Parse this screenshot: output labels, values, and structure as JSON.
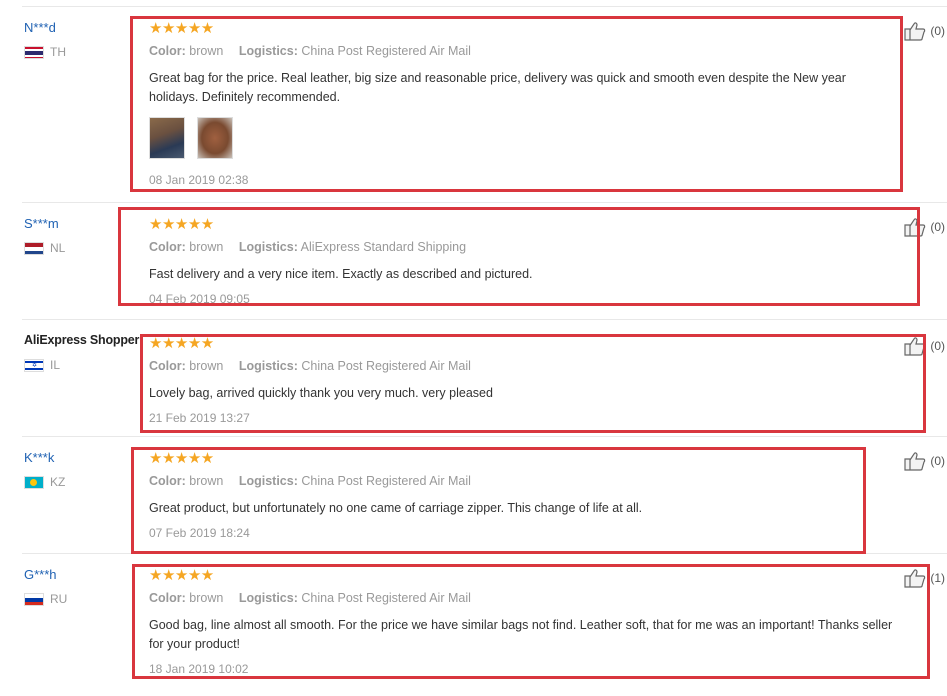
{
  "labels": {
    "color": "Color:",
    "logistics": "Logistics:"
  },
  "reviews": [
    {
      "user": "N***d",
      "country": "TH",
      "stars": "★★★★★",
      "color": "brown",
      "logistics": "China Post Registered Air Mail",
      "text": "Great bag for the price. Real leather, big size and reasonable price, delivery was quick and smooth even despite the New year holidays. Definitely recommended.",
      "date": "08 Jan 2019 02:38",
      "likes": "(0)"
    },
    {
      "user": "S***m",
      "country": "NL",
      "stars": "★★★★★",
      "color": "brown",
      "logistics": "AliExpress Standard Shipping",
      "text": "Fast delivery and a very nice item. Exactly as described and pictured.",
      "date": "04 Feb 2019 09:05",
      "likes": "(0)"
    },
    {
      "user": "AliExpress Shopper",
      "country": "IL",
      "stars": "★★★★★",
      "color": "brown",
      "logistics": "China Post Registered Air Mail",
      "text": "Lovely bag, arrived quickly thank you very much. very pleased",
      "date": "21 Feb 2019 13:27",
      "likes": "(0)"
    },
    {
      "user": "K***k",
      "country": "KZ",
      "stars": "★★★★★",
      "color": "brown",
      "logistics": "China Post Registered Air Mail",
      "text": "Great product, but unfortunately no one came of carriage zipper. This change of life at all.",
      "date": "07 Feb 2019 18:24",
      "likes": "(0)"
    },
    {
      "user": "G***h",
      "country": "RU",
      "stars": "★★★★★",
      "color": "brown",
      "logistics": "China Post Registered Air Mail",
      "text": "Good bag, line almost all smooth. For the price we have similar bags not find. Leather soft, that for me was an important! Thanks seller for your product!",
      "date": "18 Jan 2019 10:02",
      "likes": "(1)"
    }
  ],
  "colors": {
    "highlight": "#d9363e",
    "star": "#f5a623",
    "username": "#2062b3"
  }
}
